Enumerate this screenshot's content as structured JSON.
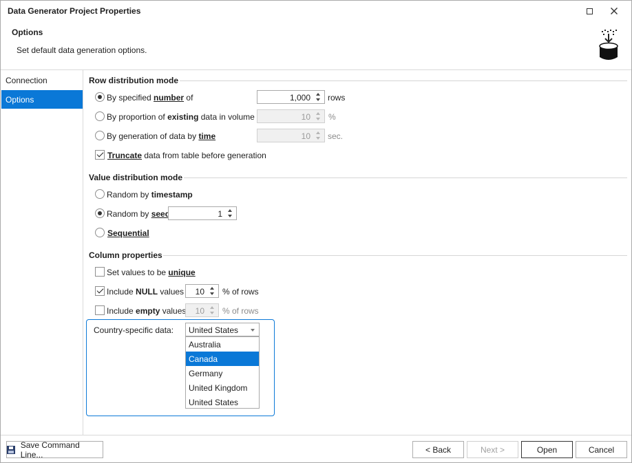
{
  "window": {
    "title": "Data Generator Project Properties"
  },
  "header": {
    "title": "Options",
    "description": "Set default data generation options."
  },
  "sidebar": {
    "items": [
      {
        "label": "Connection"
      },
      {
        "label": "Options"
      }
    ]
  },
  "row_distribution": {
    "title": "Row distribution mode",
    "opt1": {
      "pre": "By specified ",
      "bold": "number",
      "post": " of",
      "value": "1,000",
      "unit": "rows",
      "selected": true
    },
    "opt2": {
      "pre": "By proportion of ",
      "bold": "existing",
      "post": " data in volume of",
      "value": "10",
      "unit": "%",
      "selected": false
    },
    "opt3": {
      "pre": "By generation of data by ",
      "bold": "time",
      "post": "",
      "value": "10",
      "unit": "sec.",
      "selected": false
    },
    "truncate": {
      "bold": "Truncate",
      "post": " data from table before generation",
      "checked": true
    }
  },
  "value_distribution": {
    "title": "Value distribution mode",
    "opt1": {
      "pre": "Random by ",
      "bold": "timestamp"
    },
    "opt2": {
      "pre": "Random by ",
      "bold": "seed",
      "value": "1"
    },
    "opt3": {
      "bold": "Sequential"
    }
  },
  "column_properties": {
    "title": "Column properties",
    "unique": {
      "pre": "Set values to be ",
      "bold": "unique",
      "checked": false
    },
    "null": {
      "pre": "Include ",
      "bold": "NULL",
      "post": " values",
      "value": "10",
      "unit": "% of rows",
      "checked": true
    },
    "empty": {
      "pre": "Include ",
      "bold": "empty",
      "post": " values",
      "value": "10",
      "unit": "% of rows",
      "checked": false
    },
    "country": {
      "label": "Country-specific data:",
      "selected": "United States",
      "options": [
        "Australia",
        "Canada",
        "Germany",
        "United Kingdom",
        "United States"
      ],
      "highlighted": "Canada"
    }
  },
  "footer": {
    "save_command_line": "Save Command Line...",
    "back": "< Back",
    "next": "Next >",
    "open": "Open",
    "cancel": "Cancel"
  },
  "colors": {
    "accent": "#0a78d7"
  }
}
